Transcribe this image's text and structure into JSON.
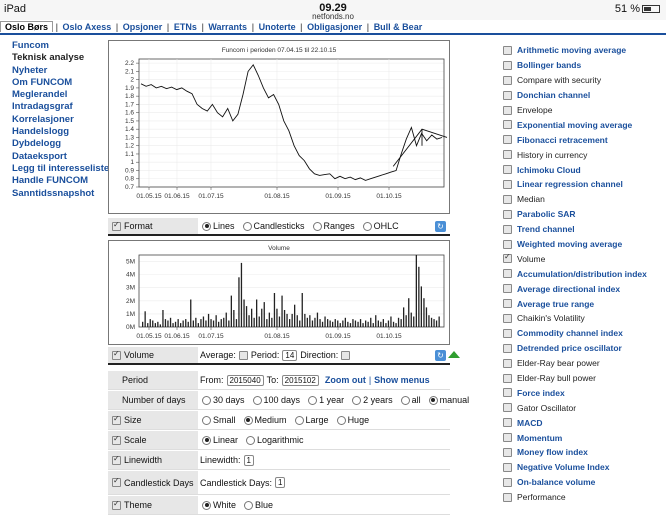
{
  "status_bar": {
    "device": "iPad",
    "time": "09.29",
    "url": "netfonds.no",
    "battery": "51 %"
  },
  "top_nav": [
    "Oslo Børs",
    "Oslo Axess",
    "Opsjoner",
    "ETNs",
    "Warrants",
    "Unoterte",
    "Obligasjoner",
    "Bull & Bear"
  ],
  "left_nav": [
    "Funcom",
    "Teknisk analyse",
    "Nyheter",
    "Om FUNCOM",
    "Meglerandel",
    "Intradagsgraf",
    "Korrelasjoner",
    "Handelslogg",
    "Dybdelogg",
    "Dataeksport",
    "Legg til interesseliste",
    "Handle FUNCOM",
    "Sanntidssnapshot"
  ],
  "chart_data": [
    {
      "type": "line",
      "title": "Funcom i perioden 07.04.15 til 22.10.15",
      "x_ticks": [
        "01.05.15",
        "01.06.15",
        "01.07.15",
        "01.08.15",
        "01.09.15",
        "01.10.15"
      ],
      "ylim": [
        0.7,
        2.25
      ],
      "y_ticks": [
        "0.7",
        "0.8",
        "0.9",
        "1",
        "1.1",
        "1.2",
        "1.3",
        "1.4",
        "1.5",
        "1.6",
        "1.7",
        "1.8",
        "1.9",
        "2",
        "2.1",
        "2.2"
      ],
      "series": [
        {
          "values": [
            1.95,
            1.92,
            1.94,
            1.9,
            1.92,
            1.89,
            1.91,
            1.88,
            1.9,
            1.86,
            1.83,
            1.7,
            1.65,
            1.62,
            1.7,
            1.6,
            1.55,
            1.65,
            1.5,
            1.58,
            1.82,
            2.1,
            2.18,
            2.05,
            1.9,
            1.78,
            1.82,
            1.7,
            1.5,
            1.38,
            1.2,
            1.08,
            1.02,
            0.92,
            0.86,
            0.84,
            0.85,
            0.86,
            0.8,
            0.83,
            0.8,
            0.82,
            0.79,
            0.81,
            0.78,
            0.8,
            0.82,
            0.84,
            0.86,
            0.88,
            0.9,
            1.1,
            1.28,
            1.42,
            1.2,
            1.35,
            1.26,
            1.33,
            1.28,
            1.3
          ]
        }
      ]
    },
    {
      "type": "bar",
      "title": "Volume",
      "x_ticks": [
        "01.05.15",
        "01.06.15",
        "01.07.15",
        "01.08.15",
        "01.09.15",
        "01.10.15"
      ],
      "ylim": [
        0,
        5.5
      ],
      "y_ticks": [
        "0M",
        "1M",
        "2M",
        "3M",
        "4M",
        "5M"
      ],
      "series": [
        {
          "name": "Volume (M)",
          "values": [
            0.4,
            1.2,
            0.3,
            0.6,
            0.5,
            0.3,
            0.4,
            0.2,
            1.3,
            0.6,
            0.5,
            0.7,
            0.3,
            0.4,
            0.6,
            0.3,
            0.5,
            0.6,
            0.4,
            2.1,
            0.5,
            0.7,
            0.3,
            0.6,
            0.8,
            0.5,
            1.0,
            0.6,
            0.5,
            0.9,
            0.4,
            0.6,
            0.7,
            1.1,
            0.5,
            2.4,
            1.3,
            0.6,
            3.8,
            4.9,
            2.1,
            1.6,
            0.9,
            1.4,
            0.7,
            2.1,
            0.8,
            1.4,
            1.9,
            0.6,
            1.1,
            0.7,
            2.6,
            1.4,
            0.8,
            2.4,
            1.3,
            1.0,
            0.6,
            1.0,
            1.7,
            0.9,
            0.5,
            2.6,
            1.0,
            0.7,
            0.9,
            0.5,
            0.7,
            1.1,
            0.6,
            0.4,
            0.8,
            0.6,
            0.5,
            0.4,
            0.6,
            0.5,
            0.3,
            0.5,
            0.7,
            0.4,
            0.3,
            0.6,
            0.5,
            0.4,
            0.6,
            0.3,
            0.5,
            0.4,
            0.7,
            0.3,
            0.9,
            0.5,
            0.4,
            0.6,
            0.3,
            0.5,
            0.8,
            0.4,
            0.3,
            0.7,
            0.6,
            1.5,
            0.9,
            2.2,
            1.1,
            0.8,
            5.5,
            4.6,
            3.1,
            2.2,
            1.5,
            0.9,
            0.7,
            0.6,
            0.5,
            0.8
          ]
        }
      ]
    }
  ],
  "controls": {
    "format": {
      "label": "Format",
      "options": [
        "Lines",
        "Candlesticks",
        "Ranges",
        "OHLC"
      ],
      "selected": "Lines"
    },
    "volume": {
      "label": "Volume",
      "average_label": "Average:",
      "period_label": "Period:",
      "period_value": "14",
      "direction_label": "Direction:"
    },
    "period": {
      "label": "Period",
      "from_label": "From:",
      "from_value": "2015040",
      "to_label": "To:",
      "to_value": "2015102",
      "zoom_out": "Zoom out",
      "show_menus": "Show menus"
    },
    "days": {
      "label": "Number of days",
      "options": [
        "30 days",
        "100 days",
        "1 year",
        "2 years",
        "all",
        "manual"
      ],
      "selected": "manual"
    },
    "size": {
      "label": "Size",
      "options": [
        "Small",
        "Medium",
        "Large",
        "Huge"
      ],
      "selected": "Medium"
    },
    "scale": {
      "label": "Scale",
      "options": [
        "Linear",
        "Logarithmic"
      ],
      "selected": "Linear"
    },
    "linewidth": {
      "label": "Linewidth",
      "field_label": "Linewidth:",
      "value": "1"
    },
    "candlestick_days": {
      "label": "Candlestick Days",
      "field_label": "Candlestick Days:",
      "value": "1"
    },
    "theme": {
      "label": "Theme",
      "options": [
        "White",
        "Blue"
      ],
      "selected": "White"
    }
  },
  "indicators": [
    {
      "label": "Arithmetic moving average",
      "link": true,
      "checked": false
    },
    {
      "label": "Bollinger bands",
      "link": true,
      "checked": false
    },
    {
      "label": "Compare with security",
      "link": false,
      "checked": false
    },
    {
      "label": "Donchian channel",
      "link": true,
      "checked": false
    },
    {
      "label": "Envelope",
      "link": false,
      "checked": false
    },
    {
      "label": "Exponential moving average",
      "link": true,
      "checked": false
    },
    {
      "label": "Fibonacci retracement",
      "link": true,
      "checked": false
    },
    {
      "label": "History in currency",
      "link": false,
      "checked": false
    },
    {
      "label": "Ichimoku Cloud",
      "link": true,
      "checked": false
    },
    {
      "label": "Linear regression channel",
      "link": true,
      "checked": false
    },
    {
      "label": "Median",
      "link": false,
      "checked": false
    },
    {
      "label": "Parabolic SAR",
      "link": true,
      "checked": false
    },
    {
      "label": "Trend channel",
      "link": true,
      "checked": false
    },
    {
      "label": "Weighted moving average",
      "link": true,
      "checked": false
    },
    {
      "label": "Volume",
      "link": false,
      "checked": true
    },
    {
      "label": "Accumulation/distribution index",
      "link": true,
      "checked": false
    },
    {
      "label": "Average directional index",
      "link": true,
      "checked": false
    },
    {
      "label": "Average true range",
      "link": true,
      "checked": false
    },
    {
      "label": "Chaikin's Volatility",
      "link": false,
      "checked": false
    },
    {
      "label": "Commodity channel index",
      "link": true,
      "checked": false
    },
    {
      "label": "Detrended price oscillator",
      "link": true,
      "checked": false
    },
    {
      "label": "Elder-Ray bear power",
      "link": false,
      "checked": false
    },
    {
      "label": "Elder-Ray bull power",
      "link": false,
      "checked": false
    },
    {
      "label": "Force index",
      "link": true,
      "checked": false
    },
    {
      "label": "Gator Oscillator",
      "link": false,
      "checked": false
    },
    {
      "label": "MACD",
      "link": true,
      "checked": false
    },
    {
      "label": "Momentum",
      "link": true,
      "checked": false
    },
    {
      "label": "Money flow index",
      "link": true,
      "checked": false
    },
    {
      "label": "Negative Volume Index",
      "link": true,
      "checked": false
    },
    {
      "label": "On-balance volume",
      "link": true,
      "checked": false
    },
    {
      "label": "Performance",
      "link": false,
      "checked": false
    }
  ]
}
